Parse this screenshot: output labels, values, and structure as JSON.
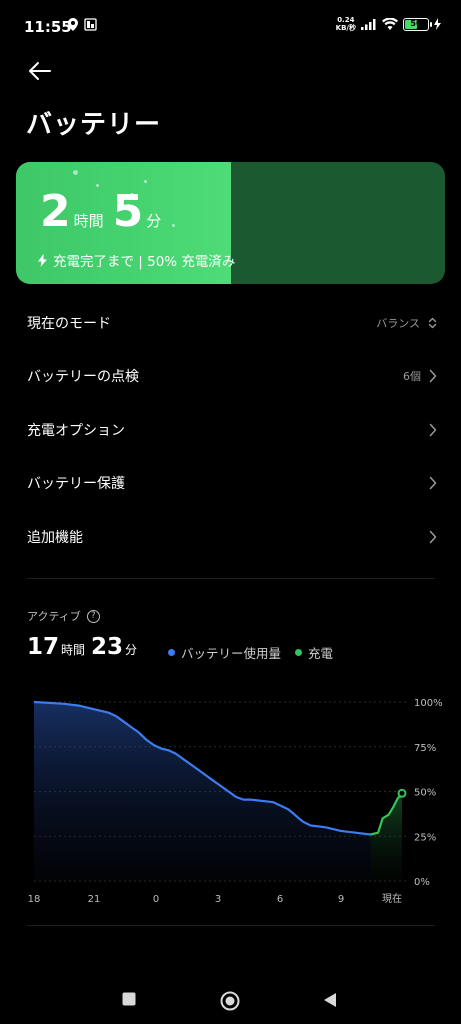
{
  "status_bar": {
    "time": "11:55",
    "net_speed_value": "0.24",
    "net_speed_unit": "KB/秒",
    "battery_level": "50"
  },
  "title": "バッテリー",
  "charge_card": {
    "hours": "2",
    "hours_unit": "時間",
    "minutes": "5",
    "minutes_unit": "分",
    "subtitle": "充電完了まで | 50% 充電済み",
    "charged_fraction": 0.5,
    "fill_color": "#45d470",
    "empty_color": "#1b5a30"
  },
  "settings": [
    {
      "label": "現在のモード",
      "value": "バランス",
      "icon": "updown-icon"
    },
    {
      "label": "バッテリーの点検",
      "value": "6個",
      "icon": "chevron-right-icon"
    },
    {
      "label": "充電オプション",
      "value": "",
      "icon": "chevron-right-icon"
    },
    {
      "label": "バッテリー保護",
      "value": "",
      "icon": "chevron-right-icon"
    },
    {
      "label": "追加機能",
      "value": "",
      "icon": "chevron-right-icon"
    }
  ],
  "active": {
    "label": "アクティブ",
    "hours": "17",
    "hours_unit": "時間",
    "minutes": "23",
    "minutes_unit": "分"
  },
  "legend": [
    {
      "label": "バッテリー使用量",
      "color": "#3d7bf0"
    },
    {
      "label": "充電",
      "color": "#35c45a"
    }
  ],
  "chart_data": {
    "type": "area",
    "x_ticks": [
      "18",
      "21",
      "0",
      "3",
      "6",
      "9",
      "現在"
    ],
    "y_ticks": [
      "100%",
      "75%",
      "50%",
      "25%",
      "0%"
    ],
    "ylim": [
      0,
      100
    ],
    "x_range": [
      18,
      35.9
    ],
    "series": [
      {
        "name": "バッテリー使用量",
        "color": "#3d7bf0",
        "points": [
          [
            18.0,
            100
          ],
          [
            19.0,
            99.5
          ],
          [
            20.0,
            99
          ],
          [
            21.0,
            98
          ],
          [
            22.0,
            96
          ],
          [
            23.0,
            94
          ],
          [
            23.5,
            92
          ],
          [
            24.0,
            89
          ],
          [
            24.5,
            86
          ],
          [
            25.0,
            83
          ],
          [
            25.5,
            79
          ],
          [
            26.0,
            76
          ],
          [
            26.5,
            74
          ],
          [
            27.0,
            73
          ],
          [
            27.5,
            71
          ],
          [
            28.0,
            68
          ],
          [
            28.5,
            65
          ],
          [
            29.0,
            62
          ],
          [
            29.5,
            59
          ],
          [
            30.0,
            56
          ],
          [
            30.5,
            53
          ],
          [
            31.0,
            50
          ],
          [
            31.5,
            47
          ],
          [
            32.0,
            45.5
          ],
          [
            32.5,
            45.5
          ],
          [
            33.0,
            45
          ],
          [
            33.5,
            44.5
          ],
          [
            34.0,
            44
          ],
          [
            34.5,
            42
          ],
          [
            35.0,
            40
          ],
          [
            35.3,
            38
          ],
          [
            35.7,
            35
          ],
          [
            36.0,
            33
          ],
          [
            36.5,
            31
          ],
          [
            37.0,
            30.5
          ],
          [
            37.5,
            30
          ],
          [
            38.0,
            29
          ],
          [
            38.5,
            28
          ],
          [
            39.0,
            27.5
          ],
          [
            39.5,
            27
          ],
          [
            40.0,
            26.5
          ],
          [
            40.5,
            26
          ]
        ]
      },
      {
        "name": "充電",
        "color": "#35c45a",
        "points": [
          [
            40.5,
            26
          ],
          [
            41.0,
            27
          ],
          [
            41.3,
            35
          ],
          [
            41.7,
            37
          ],
          [
            42.0,
            41
          ],
          [
            42.3,
            46
          ],
          [
            42.6,
            49
          ]
        ]
      }
    ]
  }
}
